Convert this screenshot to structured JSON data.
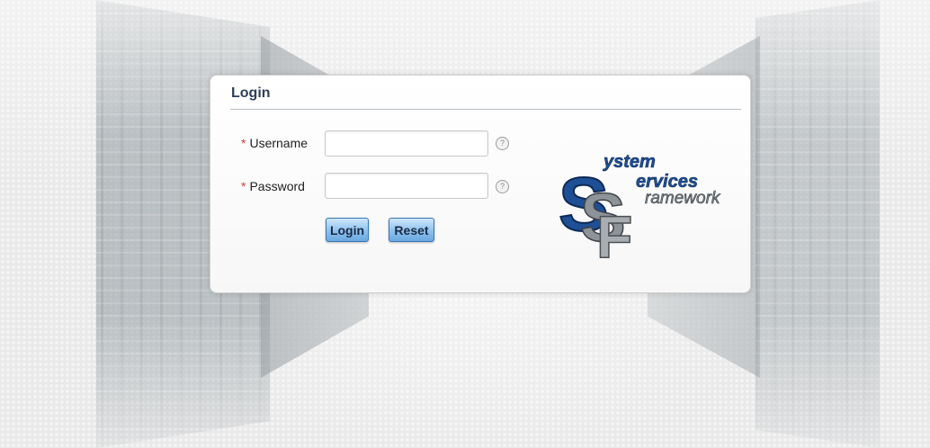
{
  "login": {
    "title": "Login",
    "required_marker": "*",
    "username": {
      "label": "Username",
      "value": "",
      "placeholder": "",
      "help": "?"
    },
    "password": {
      "label": "Password",
      "value": "",
      "placeholder": "",
      "help": "?"
    },
    "buttons": {
      "login_label": "Login",
      "reset_label": "Reset"
    }
  },
  "logo": {
    "line1": "ystem",
    "line2": "ervices",
    "line3": "ramework",
    "letter_s1": "S",
    "letter_s2": "S",
    "letter_f": "F"
  },
  "colors": {
    "title": "#2e3e5c",
    "required": "#d43b3b",
    "button_border": "#3a78b5",
    "logo_blue": "#1f4f95",
    "logo_gray": "#7d8388"
  }
}
